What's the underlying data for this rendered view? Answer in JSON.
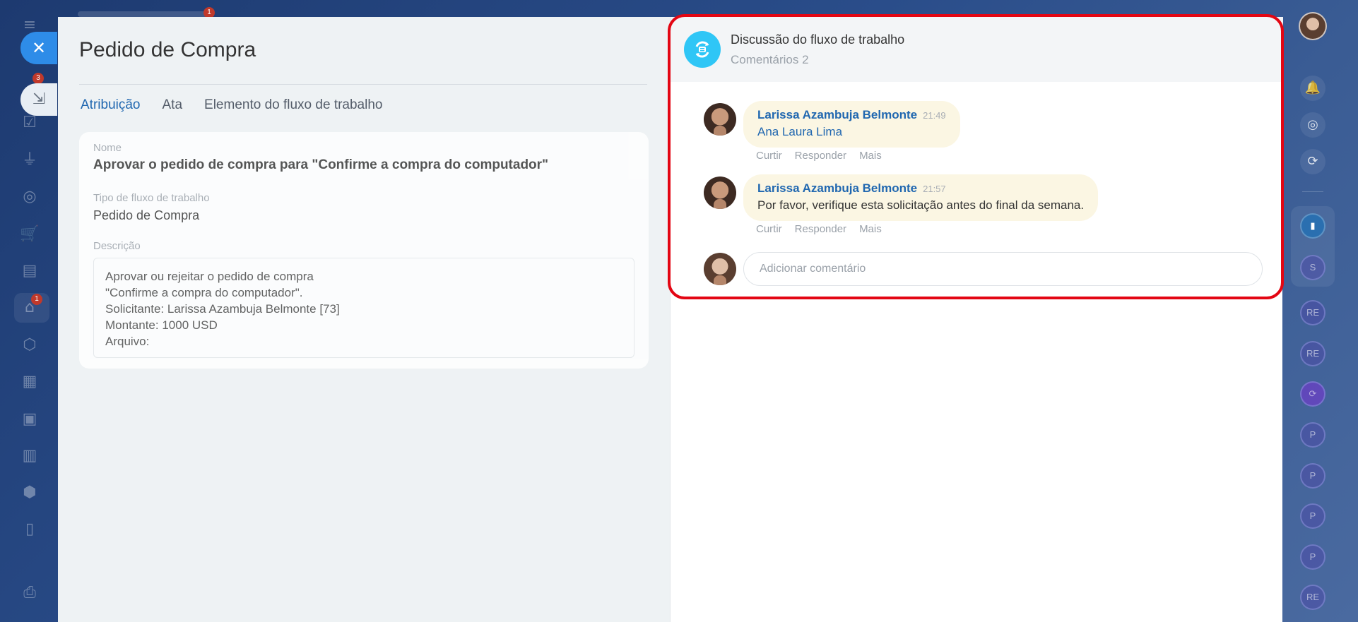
{
  "left_nav": {
    "badges": [
      "1",
      "3",
      "1"
    ]
  },
  "panel": {
    "title": "Pedido de Compra",
    "tabs": [
      {
        "label": "Atribuição",
        "active": true
      },
      {
        "label": "Ata",
        "active": false
      },
      {
        "label": "Elemento do fluxo de trabalho",
        "active": false
      }
    ],
    "fields": {
      "name_label": "Nome",
      "name_value": "Aprovar o pedido de compra para \"Confirme a compra do computador\"",
      "type_label": "Tipo de fluxo de trabalho",
      "type_value": "Pedido de Compra",
      "desc_label": "Descrição",
      "desc_lines": [
        "Aprovar ou rejeitar o pedido de compra",
        "\"Confirme a compra do computador\".",
        "Solicitante: Larissa Azambuja Belmonte [73]",
        "Montante: 1000 USD",
        "Arquivo:"
      ]
    }
  },
  "discussion": {
    "title": "Discussão do fluxo de trabalho",
    "count": "Comentários 2",
    "comments": [
      {
        "author": "Larissa Azambuja Belmonte",
        "time": "21:49",
        "text": "Ana Laura Lima"
      },
      {
        "author": "Larissa Azambuja Belmonte",
        "time": "21:57",
        "text": "Por favor, verifique esta solicitação antes do final da semana."
      }
    ],
    "actions": {
      "like": "Curtir",
      "reply": "Responder",
      "more": "Mais"
    },
    "input_placeholder": "Adicionar comentário"
  },
  "right_bar": {
    "chips": [
      "S",
      "RE",
      "RE",
      "P",
      "P",
      "P",
      "P",
      "RE"
    ]
  },
  "colors": {
    "accent_blue": "#2067b0",
    "close_button": "#2e8ce8",
    "highlight_border": "#e30613",
    "comment_bubble": "#fbf6e3",
    "discussion_icon": "#2fc6f6"
  }
}
